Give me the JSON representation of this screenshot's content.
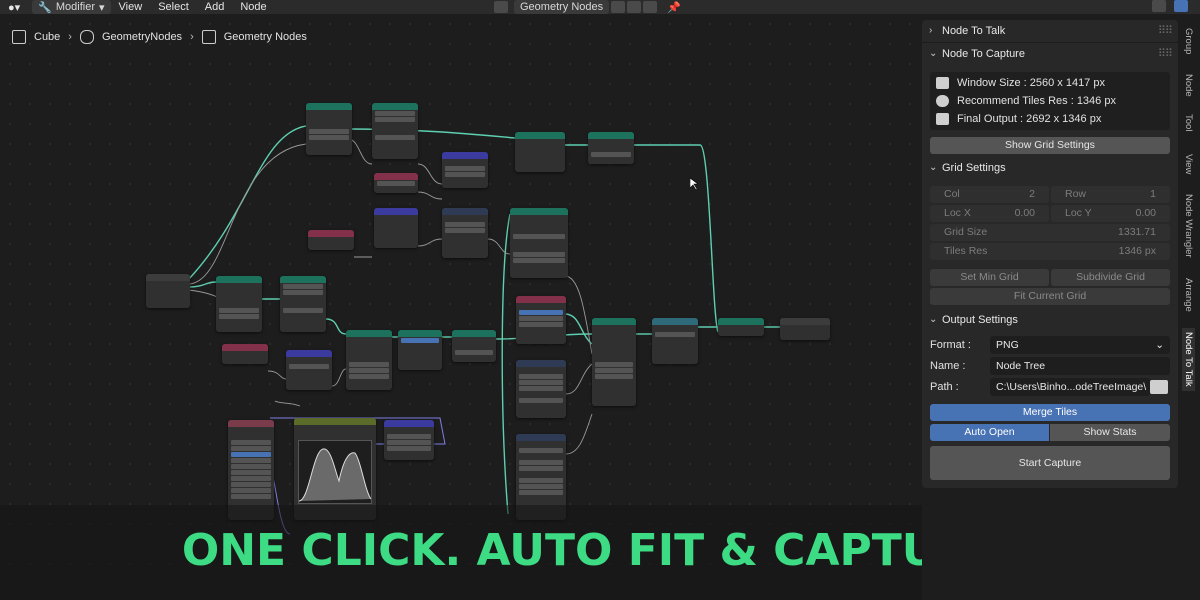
{
  "topbar": {
    "mode": "Modifier",
    "menus": [
      "View",
      "Select",
      "Add",
      "Node"
    ],
    "node_group": "Geometry Nodes"
  },
  "breadcrumb": {
    "object": "Cube",
    "modifier": "GeometryNodes",
    "tree": "Geometry Nodes"
  },
  "caption": "ONE CLICK. AUTO FIT & CAPTURE.",
  "panel": {
    "node_to_talk": "Node To Talk",
    "node_to_capture": "Node To Capture",
    "info": {
      "window_size": "Window Size : 2560 x 1417 px",
      "recommend_tiles": "Recommend Tiles Res : 1346 px",
      "final_output": "Final Output : 2692 x 1346 px"
    },
    "show_grid_settings": "Show Grid Settings",
    "grid_settings": {
      "header": "Grid Settings",
      "col_label": "Col",
      "col_value": "2",
      "row_label": "Row",
      "row_value": "1",
      "locx_label": "Loc X",
      "locx_value": "0.00",
      "locy_label": "Loc Y",
      "locy_value": "0.00",
      "grid_size_label": "Grid Size",
      "grid_size_value": "1331.71",
      "tiles_res_label": "Tiles Res",
      "tiles_res_value": "1346 px",
      "set_min_grid": "Set Min Grid",
      "subdivide_grid": "Subdivide Grid",
      "fit_current_grid": "Fit Current Grid"
    },
    "output_settings": {
      "header": "Output Settings",
      "format_label": "Format :",
      "format_value": "PNG",
      "name_label": "Name :",
      "name_value": "Node Tree",
      "path_label": "Path :",
      "path_value": "C:\\Users\\Binho...odeTreeImage\\"
    },
    "merge_tiles": "Merge Tiles",
    "auto_open": "Auto Open",
    "show_stats": "Show Stats",
    "start_capture": "Start Capture"
  },
  "side_tabs": [
    "Group",
    "Node",
    "Tool",
    "View",
    "Node Wrangler",
    "Arrange",
    "Node To Talk"
  ],
  "colors": {
    "link": "#5ecfb0",
    "accent": "#4772b3",
    "caption": "#3ddc84"
  }
}
